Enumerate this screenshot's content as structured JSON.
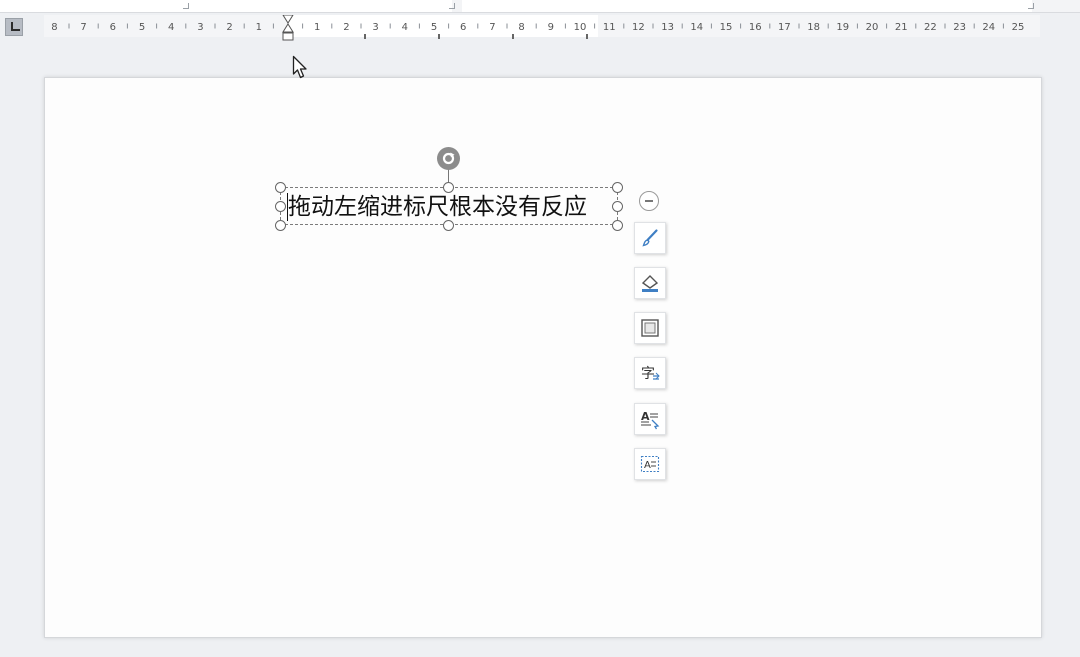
{
  "ruler": {
    "corner_icon": "tab-stop-left-icon",
    "left_labels": [
      "8",
      "7",
      "6",
      "5",
      "4",
      "3",
      "2",
      "1"
    ],
    "right_labels": [
      "1",
      "2",
      "3",
      "4",
      "5",
      "6",
      "7",
      "8",
      "9",
      "10",
      "11",
      "12",
      "13",
      "14",
      "15",
      "16",
      "17",
      "18",
      "19",
      "20",
      "21",
      "22",
      "23",
      "24",
      "25"
    ],
    "indent_marker_icon": "indent-marker-icon"
  },
  "textbox": {
    "text": "拖动左缩进标尺根本没有反应"
  },
  "float_toolbar": {
    "collapse_icon": "collapse-minus-icon",
    "items": [
      {
        "name": "shape-style-button",
        "icon": "paintbrush-icon"
      },
      {
        "name": "shape-fill-button",
        "icon": "paint-bucket-icon"
      },
      {
        "name": "shape-outline-button",
        "icon": "outline-frame-icon"
      },
      {
        "name": "text-format-button",
        "icon": "character-format-icon",
        "glyph": "字"
      },
      {
        "name": "text-effect-button",
        "icon": "text-effect-icon",
        "glyph": "A"
      },
      {
        "name": "text-wrap-button",
        "icon": "text-box-icon",
        "glyph": "A"
      }
    ]
  },
  "colors": {
    "workspace": "#eef0f3",
    "page": "#fdfdfd",
    "icon_blue": "#3f7fc4",
    "handle_gray": "#8c8c8c"
  }
}
